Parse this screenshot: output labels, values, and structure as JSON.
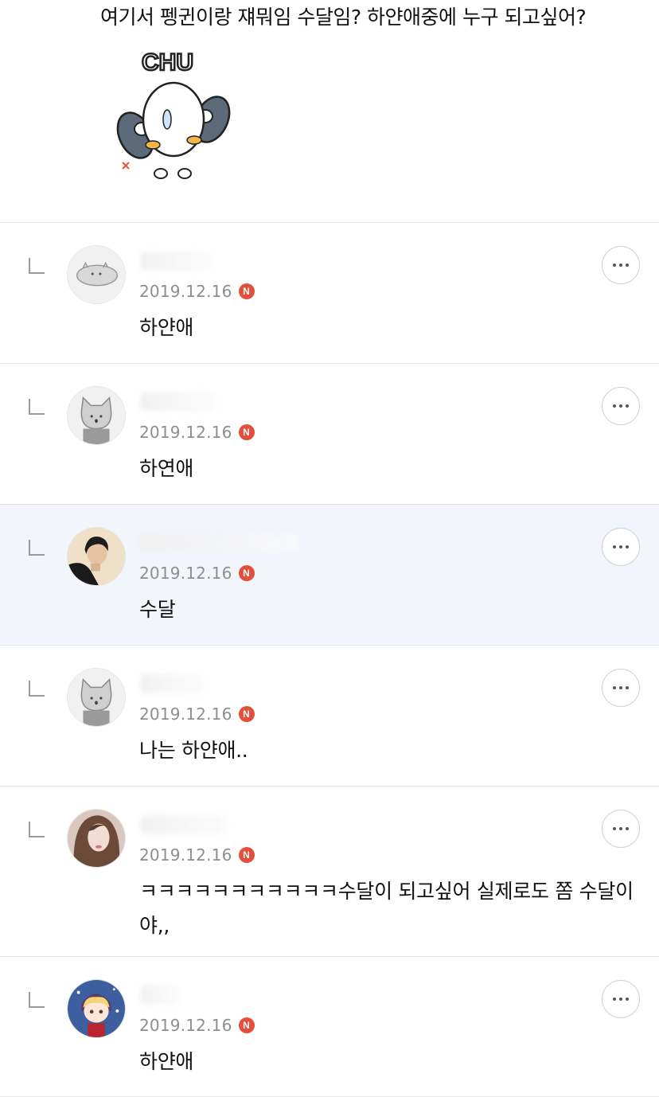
{
  "post": {
    "text": "여기서 펭귄이랑 쟤뭐임 수달임? 하얀애중에 누구 되고싶어?",
    "sticker_text": "CHU"
  },
  "comments": [
    {
      "date": "2019.12.16",
      "badge": "N",
      "text": "하얀애",
      "avatar": "gray-creature-avatar"
    },
    {
      "date": "2019.12.16",
      "badge": "N",
      "text": "하연애",
      "avatar": "gray-cat-avatar"
    },
    {
      "date": "2019.12.16",
      "badge": "N",
      "text": "수달",
      "avatar": "person-photo-avatar"
    },
    {
      "date": "2019.12.16",
      "badge": "N",
      "text": "나는 하얀애..",
      "avatar": "gray-cat-avatar"
    },
    {
      "date": "2019.12.16",
      "badge": "N",
      "text": "ㅋㅋㅋㅋㅋㅋㅋㅋㅋㅋㅋ수달이 되고싶어 실제로도 쫌 수달이야,,",
      "avatar": "person-photo-avatar"
    },
    {
      "date": "2019.12.16",
      "badge": "N",
      "text": "하얀애",
      "avatar": "anime-girl-avatar"
    }
  ],
  "colors": {
    "badge": "#e24f3d",
    "highlight_bg": "#f2f5fc",
    "date": "#8e8e8e"
  },
  "icons": {
    "more": "more-horizontal-icon",
    "reply": "reply-indent-icon"
  }
}
